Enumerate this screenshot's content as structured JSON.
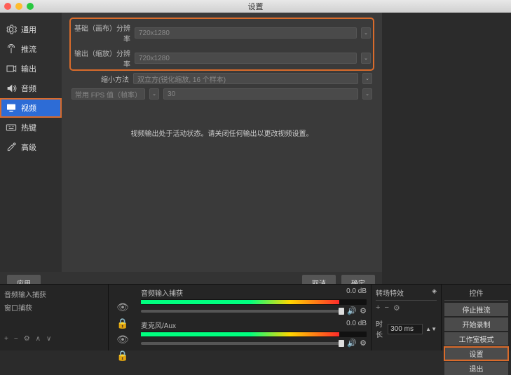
{
  "titlebar": {
    "title": "设置"
  },
  "sidebar": {
    "items": [
      {
        "label": "通用"
      },
      {
        "label": "推流"
      },
      {
        "label": "输出"
      },
      {
        "label": "音频"
      },
      {
        "label": "视频"
      },
      {
        "label": "热键"
      },
      {
        "label": "高级"
      }
    ]
  },
  "video": {
    "base_label": "基础（画布）分辨率",
    "base_value": "720x1280",
    "output_label": "输出（缩放）分辨率",
    "output_value": "720x1280",
    "scale_label": "缩小方法",
    "scale_value": "双立方(锐化缩放, 16 个样本)",
    "fps_label": "常用 FPS 值（帧率）",
    "fps_value": "30",
    "warning": "视频输出处于活动状态。请关闭任何输出以更改视频设置。"
  },
  "footer": {
    "apply": "应用",
    "cancel": "取消",
    "ok": "确定"
  },
  "sources": {
    "items": [
      "音频输入捕获",
      "窗口捕获"
    ]
  },
  "mixer": {
    "tracks": [
      {
        "name": "音频输入捕获",
        "db": "0.0 dB",
        "level": 88
      },
      {
        "name": "麦克风/Aux",
        "db": "0.0 dB",
        "level": 88
      }
    ]
  },
  "transition": {
    "header": "转场特效",
    "dur_label": "时长",
    "dur_value": "300 ms"
  },
  "controls": {
    "header": "控件",
    "buttons": [
      "停止推流",
      "开始录制",
      "工作室模式",
      "设置",
      "退出"
    ]
  }
}
